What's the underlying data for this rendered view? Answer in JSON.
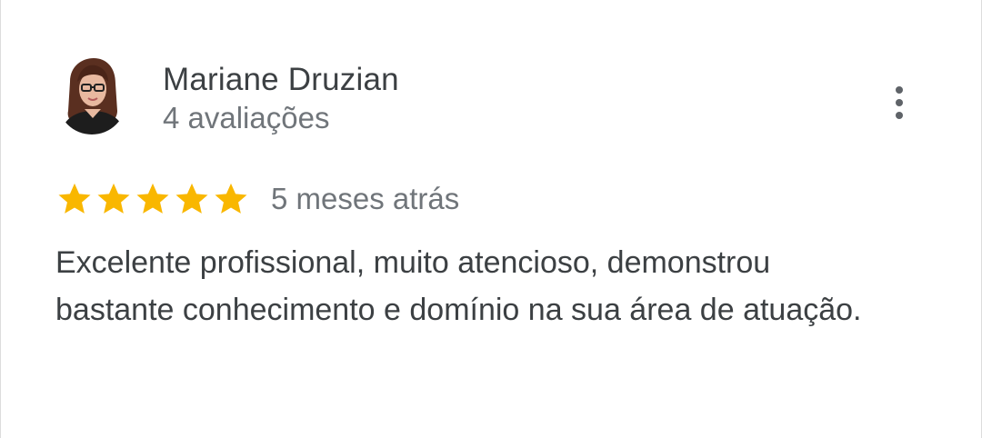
{
  "review": {
    "author": {
      "name": "Mariane Druzian",
      "reviews_count": "4 avaliações",
      "avatar_icon": "user-photo-avatar"
    },
    "menu_icon": "more-vert-icon",
    "rating": {
      "stars": 5,
      "max": 5,
      "star_color": "#f9b700",
      "star_icon": "star-icon"
    },
    "date": "5 meses atrás",
    "text": "Excelente profissional, muito atencioso, demonstrou bastante conhecimento e domínio na sua área de atuação."
  },
  "colors": {
    "name_text": "#3c4043",
    "meta_text": "#70757a",
    "star": "#f9b700"
  }
}
